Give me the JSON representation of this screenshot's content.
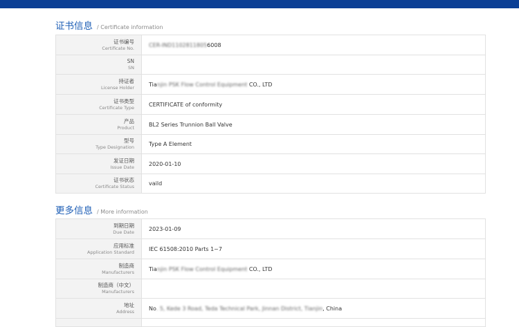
{
  "certificate_section": {
    "title_zh": "证书信息",
    "title_en": "/ Certificate information",
    "rows": [
      {
        "label_zh": "证书编号",
        "label_en": "Certificate No.",
        "value_blur": "CER-IND1102811805",
        "value": "6008"
      },
      {
        "label_zh": "SN",
        "label_en": "SN",
        "value": ""
      },
      {
        "label_zh": "持证者",
        "label_en": "License Holder",
        "value_prefix": "Tia",
        "value_blur": "njin PSK Flow Control Equipment",
        "value": " CO., LTD"
      },
      {
        "label_zh": "证书类型",
        "label_en": "Certificate Type",
        "value": "CERTIFICATE of conformity"
      },
      {
        "label_zh": "产品",
        "label_en": "Product",
        "value": "BL2 Series Trunnion Ball Valve"
      },
      {
        "label_zh": "型号",
        "label_en": "Type Designation",
        "value": "Type A Element"
      },
      {
        "label_zh": "发证日期",
        "label_en": "Issue Date",
        "value": "2020-01-10"
      },
      {
        "label_zh": "证书状态",
        "label_en": "Certificate Status",
        "value": "vaild"
      }
    ]
  },
  "more_section": {
    "title_zh": "更多信息",
    "title_en": "/ More information",
    "rows": [
      {
        "label_zh": "到期日期",
        "label_en": "Due Date",
        "value": "2023-01-09"
      },
      {
        "label_zh": "应用标准",
        "label_en": "Application Standard",
        "value": "IEC 61508:2010 Parts 1~7"
      },
      {
        "label_zh": "制造商",
        "label_en": "Manufacturers",
        "value_prefix": "Tia",
        "value_blur": "njin PSK Flow Control Equipment",
        "value": " CO., LTD"
      },
      {
        "label_zh": "制造商（中文）",
        "label_en": "Manufacturers",
        "value": ""
      },
      {
        "label_zh": "地址",
        "label_en": "Address",
        "value_prefix": "No",
        "value_blur": ". 5, Kede 3 Road, Teda Technical Park, Jinnan District, Tianjin",
        "value": ", China"
      }
    ]
  }
}
